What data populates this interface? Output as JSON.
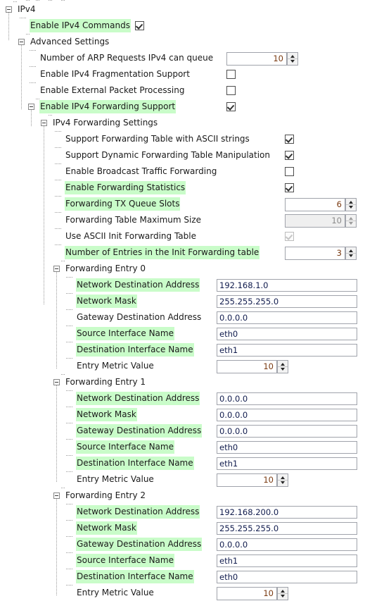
{
  "colors": {
    "highlight": "#c9fcc9",
    "field_text": "#101b4d",
    "numeric_text": "#7a3a11",
    "disabled_text": "#8a8a8a",
    "border": "#a0a3ab"
  },
  "tree": {
    "root": {
      "label": "IPv4"
    },
    "nodes": [
      {
        "id": "enable_ipv4_commands",
        "label": "Enable IPv4 Commands",
        "highlight": true,
        "control": "checkbox",
        "value": "checked"
      },
      {
        "id": "advanced_settings",
        "label": "Advanced Settings",
        "highlight": false,
        "control": "none"
      },
      {
        "id": "arp_requests",
        "label": "Number of ARP Requests IPv4 can queue",
        "highlight": false,
        "control": "spinner",
        "value": "10"
      },
      {
        "id": "ipv4_fragmentation",
        "label": "Enable IPv4 Fragmentation Support",
        "highlight": false,
        "control": "checkbox",
        "value": "unchecked"
      },
      {
        "id": "external_packet_processing",
        "label": "Enable External Packet Processing",
        "highlight": false,
        "control": "checkbox",
        "value": "unchecked"
      },
      {
        "id": "ipv4_forwarding_support",
        "label": "Enable IPv4 Forwarding Support",
        "highlight": true,
        "control": "checkbox",
        "value": "checked"
      },
      {
        "id": "ipv4_forwarding_settings",
        "label": "IPv4 Forwarding Settings",
        "highlight": false,
        "control": "none"
      },
      {
        "id": "ascii_strings_table",
        "label": "Support Forwarding Table with ASCII strings",
        "highlight": false,
        "control": "checkbox",
        "value": "checked"
      },
      {
        "id": "dynamic_table_manipulation",
        "label": "Support Dynamic Forwarding Table Manipulation",
        "highlight": false,
        "control": "checkbox",
        "value": "checked"
      },
      {
        "id": "broadcast_traffic_forwarding",
        "label": "Enable Broadcast Traffic Forwarding",
        "highlight": false,
        "control": "checkbox",
        "value": "unchecked"
      },
      {
        "id": "forwarding_statistics",
        "label": "Enable Forwarding Statistics",
        "highlight": true,
        "control": "checkbox",
        "value": "checked"
      },
      {
        "id": "tx_queue_slots",
        "label": "Forwarding TX Queue Slots",
        "highlight": true,
        "control": "spinner",
        "value": "6"
      },
      {
        "id": "table_max_size",
        "label": "Forwarding Table Maximum Size",
        "highlight": false,
        "control": "spinner",
        "value": "10",
        "disabled": true
      },
      {
        "id": "use_ascii_init_table",
        "label": "Use ASCII Init Forwarding Table",
        "highlight": false,
        "control": "checkbox",
        "value": "checked",
        "disabled": true
      },
      {
        "id": "init_table_entries",
        "label": "Number of Entries in the Init Forwarding table",
        "highlight": true,
        "control": "spinner",
        "value": "3"
      }
    ]
  },
  "entries": [
    {
      "id": "forwarding_entry_0",
      "label": "Forwarding Entry 0",
      "fields": [
        {
          "id": "network_destination_address",
          "label": "Network Destination Address",
          "highlight": true,
          "control": "text",
          "value": "192.168.1.0"
        },
        {
          "id": "network_mask",
          "label": "Network Mask",
          "highlight": true,
          "control": "text",
          "value": "255.255.255.0"
        },
        {
          "id": "gateway_destination_address",
          "label": "Gateway Destination Address",
          "highlight": false,
          "control": "text",
          "value": "0.0.0.0"
        },
        {
          "id": "source_interface_name",
          "label": "Source Interface Name",
          "highlight": true,
          "control": "text",
          "value": "eth0"
        },
        {
          "id": "destination_interface_name",
          "label": "Destination Interface Name",
          "highlight": true,
          "control": "text",
          "value": "eth1"
        },
        {
          "id": "entry_metric_value",
          "label": "Entry Metric Value",
          "highlight": false,
          "control": "spinner",
          "value": "10"
        }
      ]
    },
    {
      "id": "forwarding_entry_1",
      "label": "Forwarding Entry 1",
      "fields": [
        {
          "id": "network_destination_address",
          "label": "Network Destination Address",
          "highlight": true,
          "control": "text",
          "value": "0.0.0.0"
        },
        {
          "id": "network_mask",
          "label": "Network Mask",
          "highlight": true,
          "control": "text",
          "value": "0.0.0.0"
        },
        {
          "id": "gateway_destination_address",
          "label": "Gateway Destination Address",
          "highlight": true,
          "control": "text",
          "value": "0.0.0.0"
        },
        {
          "id": "source_interface_name",
          "label": "Source Interface Name",
          "highlight": true,
          "control": "text",
          "value": "eth0"
        },
        {
          "id": "destination_interface_name",
          "label": "Destination Interface Name",
          "highlight": true,
          "control": "text",
          "value": "eth1"
        },
        {
          "id": "entry_metric_value",
          "label": "Entry Metric Value",
          "highlight": false,
          "control": "spinner",
          "value": "10"
        }
      ]
    },
    {
      "id": "forwarding_entry_2",
      "label": "Forwarding Entry 2",
      "fields": [
        {
          "id": "network_destination_address",
          "label": "Network Destination Address",
          "highlight": true,
          "control": "text",
          "value": "192.168.200.0"
        },
        {
          "id": "network_mask",
          "label": "Network Mask",
          "highlight": true,
          "control": "text",
          "value": "255.255.255.0"
        },
        {
          "id": "gateway_destination_address",
          "label": "Gateway Destination Address",
          "highlight": true,
          "control": "text",
          "value": "0.0.0.0"
        },
        {
          "id": "source_interface_name",
          "label": "Source Interface Name",
          "highlight": true,
          "control": "text",
          "value": "eth1"
        },
        {
          "id": "destination_interface_name",
          "label": "Destination Interface Name",
          "highlight": true,
          "control": "text",
          "value": "eth0"
        },
        {
          "id": "entry_metric_value",
          "label": "Entry Metric Value",
          "highlight": false,
          "control": "spinner",
          "value": "10"
        }
      ]
    }
  ]
}
